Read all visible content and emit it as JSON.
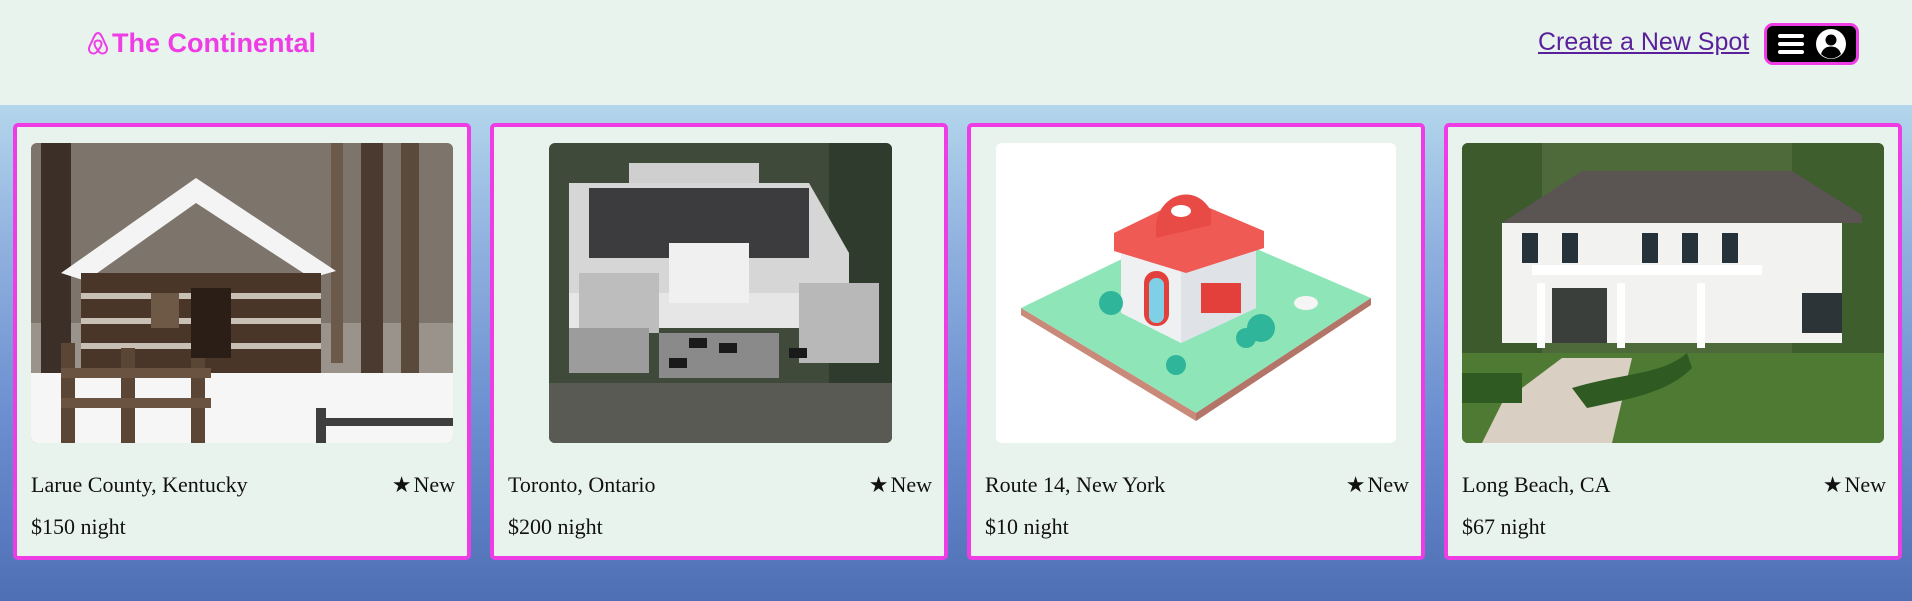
{
  "header": {
    "brand": "The Continental",
    "brand_icon": "airbnb-logo-icon",
    "create_link": "Create a New Spot",
    "menu_icons": [
      "hamburger-menu-icon",
      "user-avatar-icon"
    ]
  },
  "colors": {
    "accent": "#ef3de6",
    "header_bg": "#e9f3ee",
    "link": "#5a1f9a"
  },
  "spots": [
    {
      "location": "Larue County, Kentucky",
      "rating": "New",
      "price": "$150 night",
      "image": "snowy log cabin"
    },
    {
      "location": "Toronto, Ontario",
      "rating": "New",
      "price": "$200 night",
      "image": "aerial view of mansion"
    },
    {
      "location": "Route 14, New York",
      "rating": "New",
      "price": "$10 night",
      "image": "isometric cartoon house"
    },
    {
      "location": "Long Beach, CA",
      "rating": "New",
      "price": "$67 night",
      "image": "white colonial house with garden"
    }
  ]
}
